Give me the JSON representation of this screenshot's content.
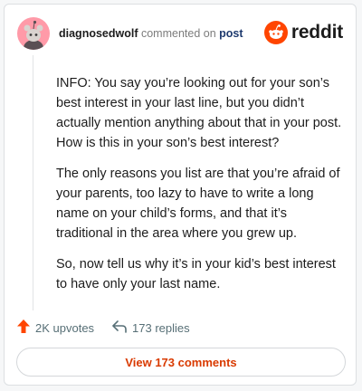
{
  "header": {
    "username": "diagnosedwolf",
    "commented_text": "commented on",
    "post_link": "post",
    "logo_text": "reddit"
  },
  "comment": {
    "paragraphs": [
      "INFO: You say you’re looking out for your son’s best interest in your last line, but you didn’t actually mention anything about that in your post. How is this in your son’s best interest?",
      "The only reasons you list are that you’re afraid of your parents, too lazy to have to write a long name on your child’s forms, and that it’s traditional in the area where you grew up.",
      "So, now tell us why it’s in your kid’s best interest to have only your last name."
    ]
  },
  "actions": {
    "upvotes": "2K upvotes",
    "replies": "173 replies",
    "view_comments": "View 173 comments"
  },
  "colors": {
    "brand": "#ff4500",
    "avatar_bg": "#ff9aa8",
    "link": "#1e3a6e",
    "button_text": "#d93a00"
  },
  "icons": {
    "avatar": "snoo-avatar-icon",
    "logo": "reddit-logo-icon",
    "upvote": "upvote-arrow-icon",
    "reply": "reply-arrow-icon"
  }
}
